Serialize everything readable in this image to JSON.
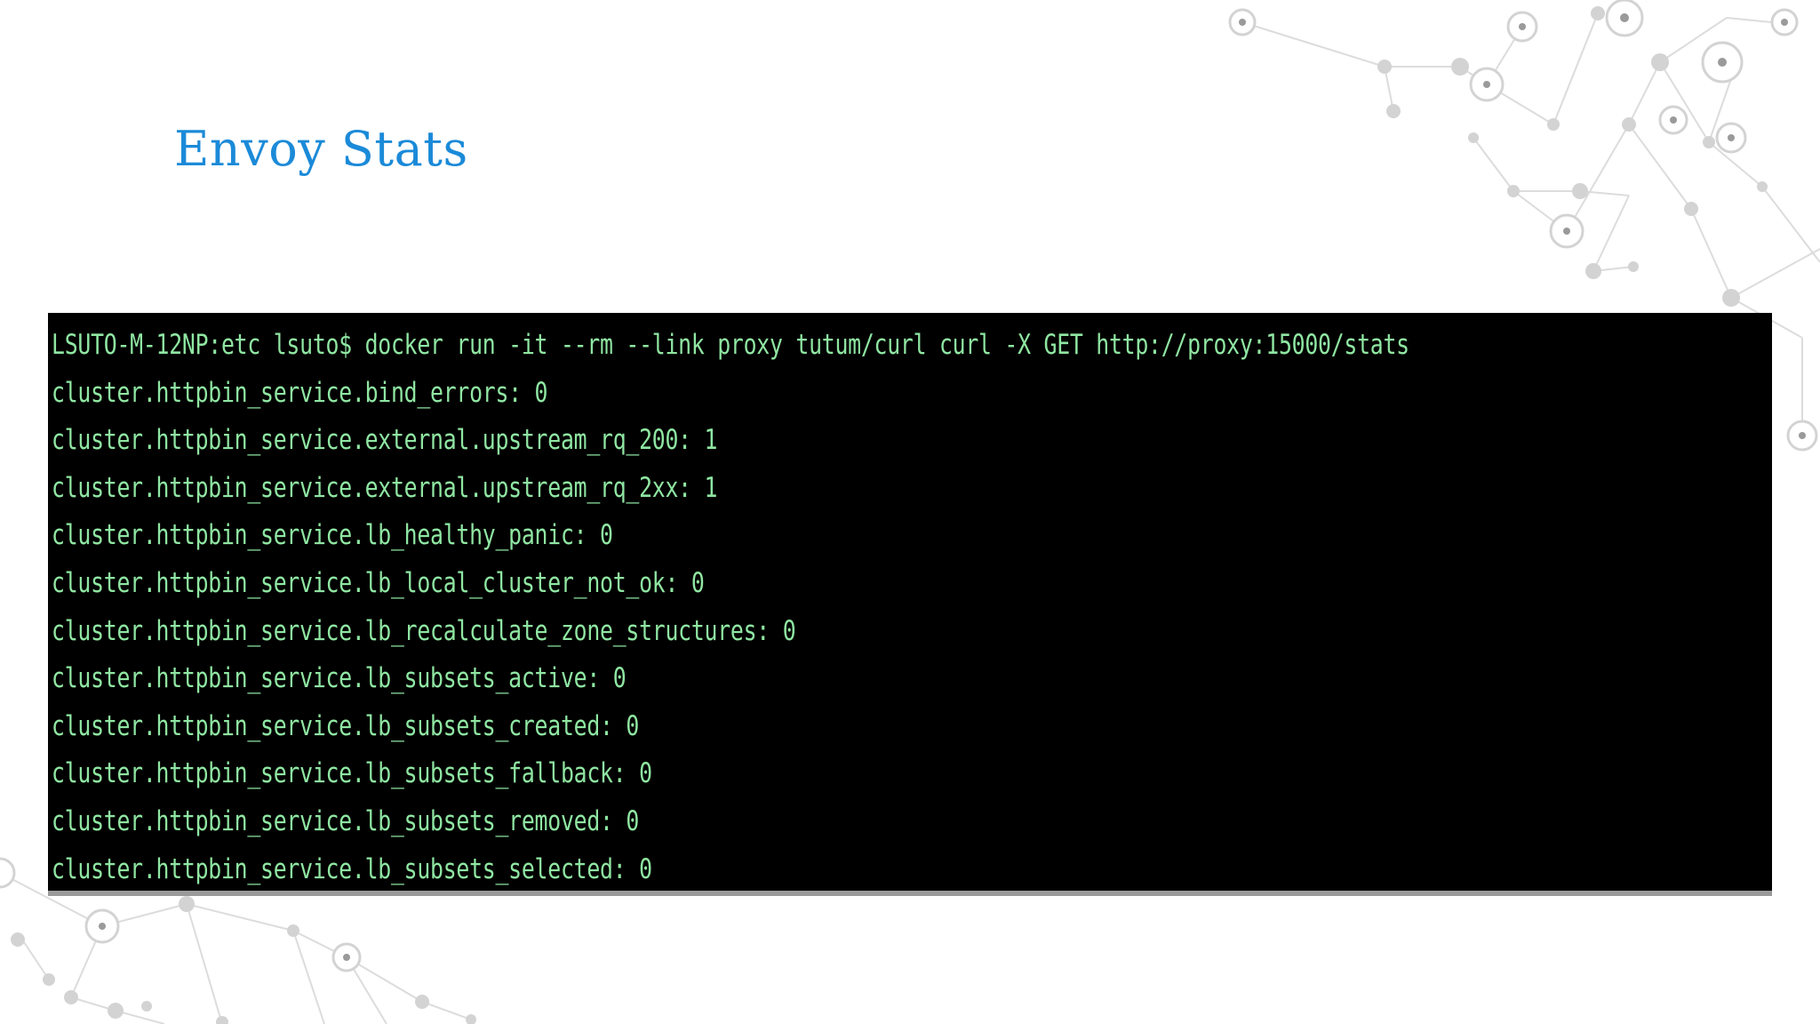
{
  "slide": {
    "title": "Envoy Stats"
  },
  "terminal": {
    "lines": [
      "LSUTO-M-12NP:etc lsuto$ docker run -it --rm --link proxy tutum/curl curl -X GET http://proxy:15000/stats",
      "cluster.httpbin_service.bind_errors: 0",
      "cluster.httpbin_service.external.upstream_rq_200: 1",
      "cluster.httpbin_service.external.upstream_rq_2xx: 1",
      "cluster.httpbin_service.lb_healthy_panic: 0",
      "cluster.httpbin_service.lb_local_cluster_not_ok: 0",
      "cluster.httpbin_service.lb_recalculate_zone_structures: 0",
      "cluster.httpbin_service.lb_subsets_active: 0",
      "cluster.httpbin_service.lb_subsets_created: 0",
      "cluster.httpbin_service.lb_subsets_fallback: 0",
      "cluster.httpbin_service.lb_subsets_removed: 0",
      "cluster.httpbin_service.lb_subsets_selected: 0"
    ]
  },
  "colors": {
    "title": "#1b8ad8",
    "terminal_bg": "#000000",
    "terminal_text": "#8fe6a2"
  },
  "icons": [
    "network-nodes-decoration"
  ]
}
